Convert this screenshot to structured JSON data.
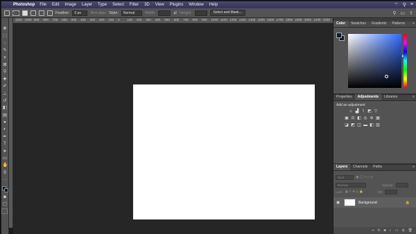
{
  "menubar": {
    "app_name": "Photoshop",
    "items": [
      "File",
      "Edit",
      "Image",
      "Layer",
      "Type",
      "Select",
      "Filter",
      "3D",
      "View",
      "Plugins",
      "Window",
      "Help"
    ]
  },
  "options_bar": {
    "feather_label": "Feather:",
    "feather_value": "0 px",
    "antialias_label": "Anti-alias",
    "style_label": "Style:",
    "style_value": "Normal",
    "width_label": "Width:",
    "height_label": "Height:",
    "select_mask_label": "Select and Mask..."
  },
  "ruler": {
    "ticks": [
      "1100",
      "1000",
      "900",
      "800",
      "700",
      "600",
      "500",
      "400",
      "300",
      "200",
      "100",
      "0",
      "100",
      "200",
      "300",
      "400",
      "500",
      "600",
      "700",
      "800",
      "900",
      "1000",
      "1100",
      "1200",
      "1300",
      "1400",
      "1500",
      "1600",
      "1700",
      "1800",
      "1900",
      "2000",
      "2100",
      "2200"
    ]
  },
  "color_panel": {
    "tabs": [
      "Color",
      "Swatches",
      "Gradients",
      "Patterns"
    ],
    "foreground": "#0e1c2c",
    "background": "#0e1c2c"
  },
  "adjustments_panel": {
    "tabs": [
      "Properties",
      "Adjustments",
      "Libraries"
    ],
    "title": "Add an adjustment"
  },
  "layers_panel": {
    "tabs": [
      "Layers",
      "Channels",
      "Paths"
    ],
    "filter_placeholder": "Kind",
    "blend_mode": "Normal",
    "opacity_label": "Opacity:",
    "lock_label": "Lock:",
    "fill_label": "Fill:",
    "layers": [
      {
        "name": "Background"
      }
    ]
  },
  "colors": {
    "workspace": "#262626",
    "document": "#ffffff",
    "menubar": "#3b3a60"
  }
}
